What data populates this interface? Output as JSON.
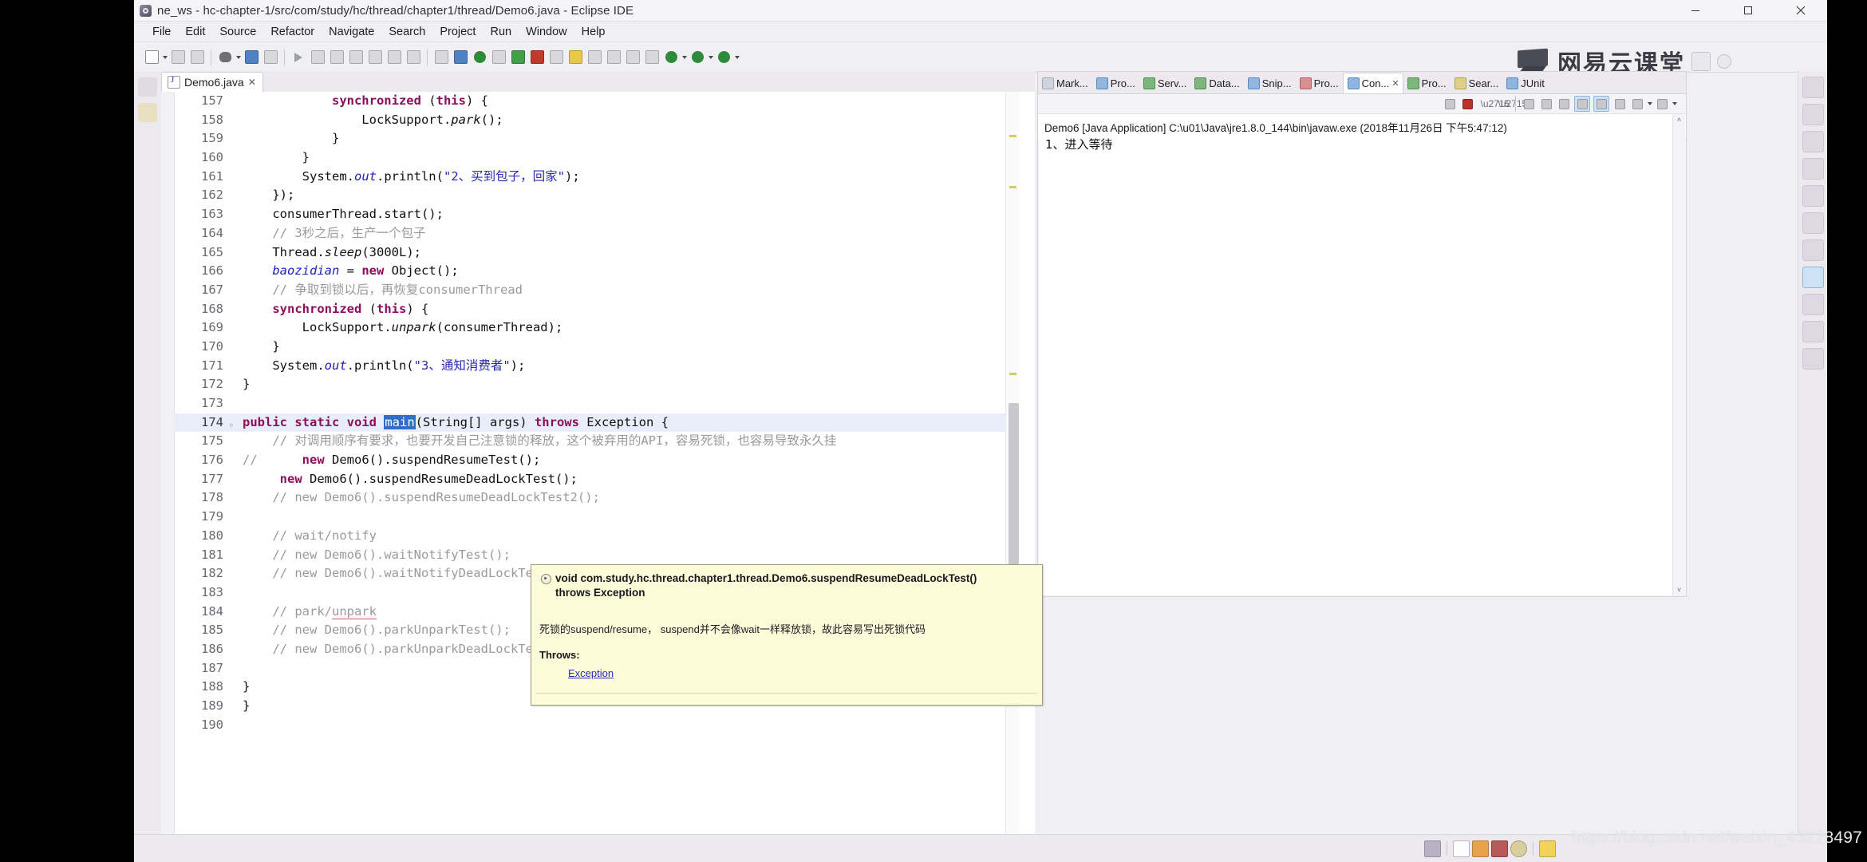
{
  "window": {
    "title": "ne_ws - hc-chapter-1/src/com/study/hc/thread/chapter1/thread/Demo6.java - Eclipse IDE",
    "minimize_label": "–",
    "maximize_label": "☐",
    "close_label": "✕"
  },
  "menu": [
    {
      "label": "File",
      "mnemonic": "F"
    },
    {
      "label": "Edit",
      "mnemonic": "E"
    },
    {
      "label": "Source",
      "mnemonic": "S"
    },
    {
      "label": "Refactor",
      "mnemonic": "N"
    },
    {
      "label": "Navigate",
      "mnemonic": "N"
    },
    {
      "label": "Search",
      "mnemonic": "S"
    },
    {
      "label": "Project",
      "mnemonic": "P"
    },
    {
      "label": "Run",
      "mnemonic": "R"
    },
    {
      "label": "Window",
      "mnemonic": "W"
    },
    {
      "label": "Help",
      "mnemonic": "H"
    }
  ],
  "brand": {
    "text": "网易云课堂",
    "monitor_icon": "monitor-icon"
  },
  "editor": {
    "tab_label": "Demo6.java",
    "tab_close": "✕",
    "lines": [
      {
        "num": "157",
        "fold": "",
        "cur": false,
        "html": "            <span class=\"kw\">synchronized</span> (<span class=\"kw\">this</span>) {"
      },
      {
        "num": "158",
        "fold": "",
        "cur": false,
        "html": "                LockSupport.<span class=\"mth\">park</span>();"
      },
      {
        "num": "159",
        "fold": "",
        "cur": false,
        "html": "            }"
      },
      {
        "num": "160",
        "fold": "",
        "cur": false,
        "html": "        }"
      },
      {
        "num": "161",
        "fold": "",
        "cur": false,
        "html": "        System.<span class=\"fld\">out</span>.println(<span class=\"str\">\"2、买到包子，回家\"</span>);"
      },
      {
        "num": "162",
        "fold": "",
        "cur": false,
        "html": "    });"
      },
      {
        "num": "163",
        "fold": "",
        "cur": false,
        "html": "    consumerThread.start();"
      },
      {
        "num": "164",
        "fold": "",
        "cur": false,
        "html": "    <span class=\"cmt2\">// 3秒之后，生产一个包子</span>"
      },
      {
        "num": "165",
        "fold": "",
        "cur": false,
        "html": "    Thread.<span class=\"mth\">sleep</span>(3000L);"
      },
      {
        "num": "166",
        "fold": "",
        "cur": false,
        "html": "    <span class=\"fld\">baozidian</span> = <span class=\"kw\">new</span> Object();"
      },
      {
        "num": "167",
        "fold": "",
        "cur": false,
        "html": "    <span class=\"cmt2\">// 争取到锁以后，再恢复consumerThread</span>"
      },
      {
        "num": "168",
        "fold": "",
        "cur": false,
        "html": "    <span class=\"kw\">synchronized</span> (<span class=\"kw\">this</span>) {"
      },
      {
        "num": "169",
        "fold": "",
        "cur": false,
        "html": "        LockSupport.<span class=\"mth\">unpark</span>(consumerThread);"
      },
      {
        "num": "170",
        "fold": "",
        "cur": false,
        "html": "    }"
      },
      {
        "num": "171",
        "fold": "",
        "cur": false,
        "html": "    System.<span class=\"fld\">out</span>.println(<span class=\"str\">\"3、通知消费者\"</span>);"
      },
      {
        "num": "172",
        "fold": "",
        "cur": false,
        "html": "}"
      },
      {
        "num": "173",
        "fold": "",
        "cur": false,
        "html": ""
      },
      {
        "num": "174",
        "fold": "◦",
        "cur": true,
        "html": "<span class=\"kw\">public static void</span> <span class=\"sel-main\">main</span>(String[] args) <span class=\"kw\">throws</span> Exception {"
      },
      {
        "num": "175",
        "fold": "",
        "cur": false,
        "html": "    <span class=\"cmt2\">// 对调用顺序有要求，也要开发自己注意锁的释放，这个被弃用的API，容易死锁，也容易导致永久挂</span>"
      },
      {
        "num": "176",
        "fold": "",
        "cur": false,
        "html": "<span class=\"cmt2\">//</span>      <span class=\"kw\">new</span> Demo6().suspendResumeTest();"
      },
      {
        "num": "177",
        "fold": "",
        "cur": false,
        "html": "     <span class=\"kw\">new</span> Demo6().suspendResumeDeadLockTest();"
      },
      {
        "num": "178",
        "fold": "",
        "cur": false,
        "html": "    <span class=\"cmt2\">// new Demo6().suspendResumeDeadLockTest2();</span>"
      },
      {
        "num": "179",
        "fold": "",
        "cur": false,
        "html": ""
      },
      {
        "num": "180",
        "fold": "",
        "cur": false,
        "html": "    <span class=\"cmt2\">// wait/notify</span>"
      },
      {
        "num": "181",
        "fold": "",
        "cur": false,
        "html": "    <span class=\"cmt2\">// new Demo6().waitNotifyTest();</span>"
      },
      {
        "num": "182",
        "fold": "",
        "cur": false,
        "html": "    <span class=\"cmt2\">// new Demo6().waitNotifyDeadLockTest();</span>"
      },
      {
        "num": "183",
        "fold": "",
        "cur": false,
        "html": ""
      },
      {
        "num": "184",
        "fold": "",
        "cur": false,
        "html": "    <span class=\"cmt2\">// park/<span class=\"ul\">unpark</span></span>"
      },
      {
        "num": "185",
        "fold": "",
        "cur": false,
        "html": "    <span class=\"cmt2\">// new Demo6().parkUnparkTest();</span>"
      },
      {
        "num": "186",
        "fold": "",
        "cur": false,
        "html": "    <span class=\"cmt2\">// new Demo6().parkUnparkDeadLockTest();</span>"
      },
      {
        "num": "187",
        "fold": "",
        "cur": false,
        "html": ""
      },
      {
        "num": "188",
        "fold": "",
        "cur": false,
        "html": "}"
      },
      {
        "num": "189",
        "fold": "",
        "cur": false,
        "html": "}"
      },
      {
        "num": "190",
        "fold": "",
        "cur": false,
        "html": ""
      }
    ],
    "scroll_left": "‹",
    "scroll_right": "›"
  },
  "hover": {
    "signature": "void com.study.hc.thread.chapter1.thread.Demo6.suspendResumeDeadLockTest()",
    "signature2": "throws Exception",
    "description": "死锁的suspend/resume， suspend并不会像wait一样释放锁，故此容易写出死锁代码",
    "throws_label": "Throws:",
    "throws_value": "Exception"
  },
  "console": {
    "tabs": [
      {
        "label": "Mark...",
        "icon": "marker-icon",
        "active": false
      },
      {
        "label": "Pro...",
        "icon": "problems-icon",
        "active": false
      },
      {
        "label": "Serv...",
        "icon": "servers-icon",
        "active": false
      },
      {
        "label": "Data...",
        "icon": "data-source-icon",
        "active": false
      },
      {
        "label": "Snip...",
        "icon": "snippets-icon",
        "active": false
      },
      {
        "label": "Pro...",
        "icon": "progress-icon",
        "active": false
      },
      {
        "label": "Con...",
        "icon": "console-icon",
        "active": true
      },
      {
        "label": "Pro...",
        "icon": "properties-icon",
        "active": false
      },
      {
        "label": "Sear...",
        "icon": "search-icon",
        "active": false
      },
      {
        "label": "JUnit",
        "icon": "junit-icon",
        "active": false
      }
    ],
    "tab_close": "✕",
    "launch_header": "Demo6 [Java Application] C:\\u01\\Java\\jre1.8.0_144\\bin\\javaw.exe (2018年11月26日 下午5:47:12)",
    "output": [
      "1、进入等待"
    ],
    "scroll_up": "˄",
    "scroll_down": "˅"
  },
  "watermark": "https://blog.csdn.net/weixin_43228497"
}
